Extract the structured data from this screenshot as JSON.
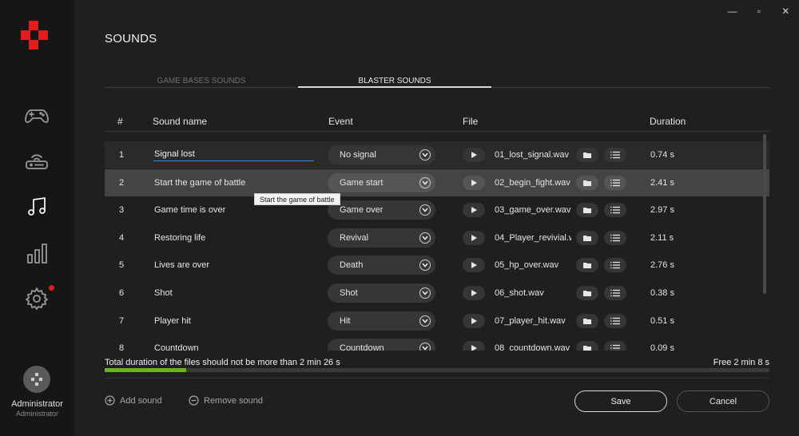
{
  "window": {
    "minimize": "—",
    "restore": "▫",
    "close": "✕"
  },
  "sidebar": {
    "items": [
      {
        "name": "gamepad-icon"
      },
      {
        "name": "router-icon"
      },
      {
        "name": "music-note-icon",
        "active": true
      },
      {
        "name": "bar-chart-icon"
      },
      {
        "name": "gear-icon",
        "notification": true
      }
    ],
    "user": {
      "name": "Administrator",
      "role": "Administrator"
    }
  },
  "page": {
    "title": "SOUNDS",
    "tabs": [
      {
        "label": "GAME BASES SOUNDS",
        "active": false
      },
      {
        "label": "BLASTER SOUNDS",
        "active": true
      }
    ]
  },
  "table": {
    "headers": {
      "num": "#",
      "name": "Sound name",
      "event": "Event",
      "file": "File",
      "duration": "Duration"
    },
    "rows": [
      {
        "num": "1",
        "name": "Signal lost",
        "event": "No signal",
        "file": "01_lost_signal.wav",
        "duration": "0.74 s",
        "editing": true
      },
      {
        "num": "2",
        "name": "Start the game of battle",
        "event": "Game start",
        "file": "02_begin_fight.wav",
        "duration": "2.41 s",
        "selected": true
      },
      {
        "num": "3",
        "name": "Game time is over",
        "event": "Game over",
        "file": "03_game_over.wav",
        "duration": "2.97 s"
      },
      {
        "num": "4",
        "name": "Restoring life",
        "event": "Revival",
        "file": "04_Player_revivial.w",
        "duration": "2.11 s"
      },
      {
        "num": "5",
        "name": "Lives are over",
        "event": "Death",
        "file": "05_hp_over.wav",
        "duration": "2.76 s"
      },
      {
        "num": "6",
        "name": "Shot",
        "event": "Shot",
        "file": "06_shot.wav",
        "duration": "0.38 s"
      },
      {
        "num": "7",
        "name": "Player hit",
        "event": "Hit",
        "file": "07_player_hit.wav",
        "duration": "0.51 s"
      },
      {
        "num": "8",
        "name": "Countdown",
        "event": "Countdown",
        "file": "08_countdown.wav",
        "duration": "0.09 s"
      }
    ]
  },
  "tooltip": "Start the game of battle",
  "footer": {
    "total_text": "Total duration of the files should not be more than 2 min 26 s",
    "free_text": "Free 2 min 8 s",
    "progress_fraction": 0.123,
    "progress_color": "#6bb21f",
    "add_label": "Add sound",
    "remove_label": "Remove sound",
    "save_label": "Save",
    "cancel_label": "Cancel"
  }
}
